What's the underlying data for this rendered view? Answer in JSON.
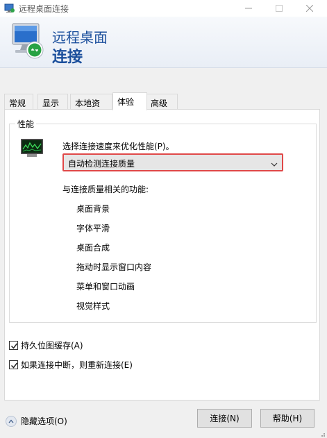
{
  "window": {
    "title": "远程桌面连接",
    "controls": {
      "minimize": "minimize-icon",
      "maximize": "maximize-icon",
      "close": "close-icon"
    }
  },
  "banner": {
    "line1": "远程桌面",
    "line2": "连接"
  },
  "tabs": [
    {
      "label": "常规"
    },
    {
      "label": "显示"
    },
    {
      "label": "本地资源"
    },
    {
      "label": "体验",
      "active": true
    },
    {
      "label": "高级"
    }
  ],
  "performance": {
    "group_label": "性能",
    "prompt": "选择连接速度来优化性能(P)。",
    "select_value": "自动检测连接质量",
    "related_label": "与连接质量相关的功能:",
    "features": [
      "桌面背景",
      "字体平滑",
      "桌面合成",
      "拖动时显示窗口内容",
      "菜单和窗口动画",
      "视觉样式"
    ]
  },
  "options": {
    "bitmap_cache": {
      "label": "持久位图缓存(A)",
      "checked": true
    },
    "reconnect": {
      "label": "如果连接中断，则重新连接(E)",
      "checked": true
    }
  },
  "footer": {
    "hide_options": "隐藏选项(O)",
    "connect_button": "连接(N)",
    "help_button": "帮助(H)"
  },
  "colors": {
    "accent_blue": "#1b4f9c",
    "select_border": "#e04848"
  }
}
